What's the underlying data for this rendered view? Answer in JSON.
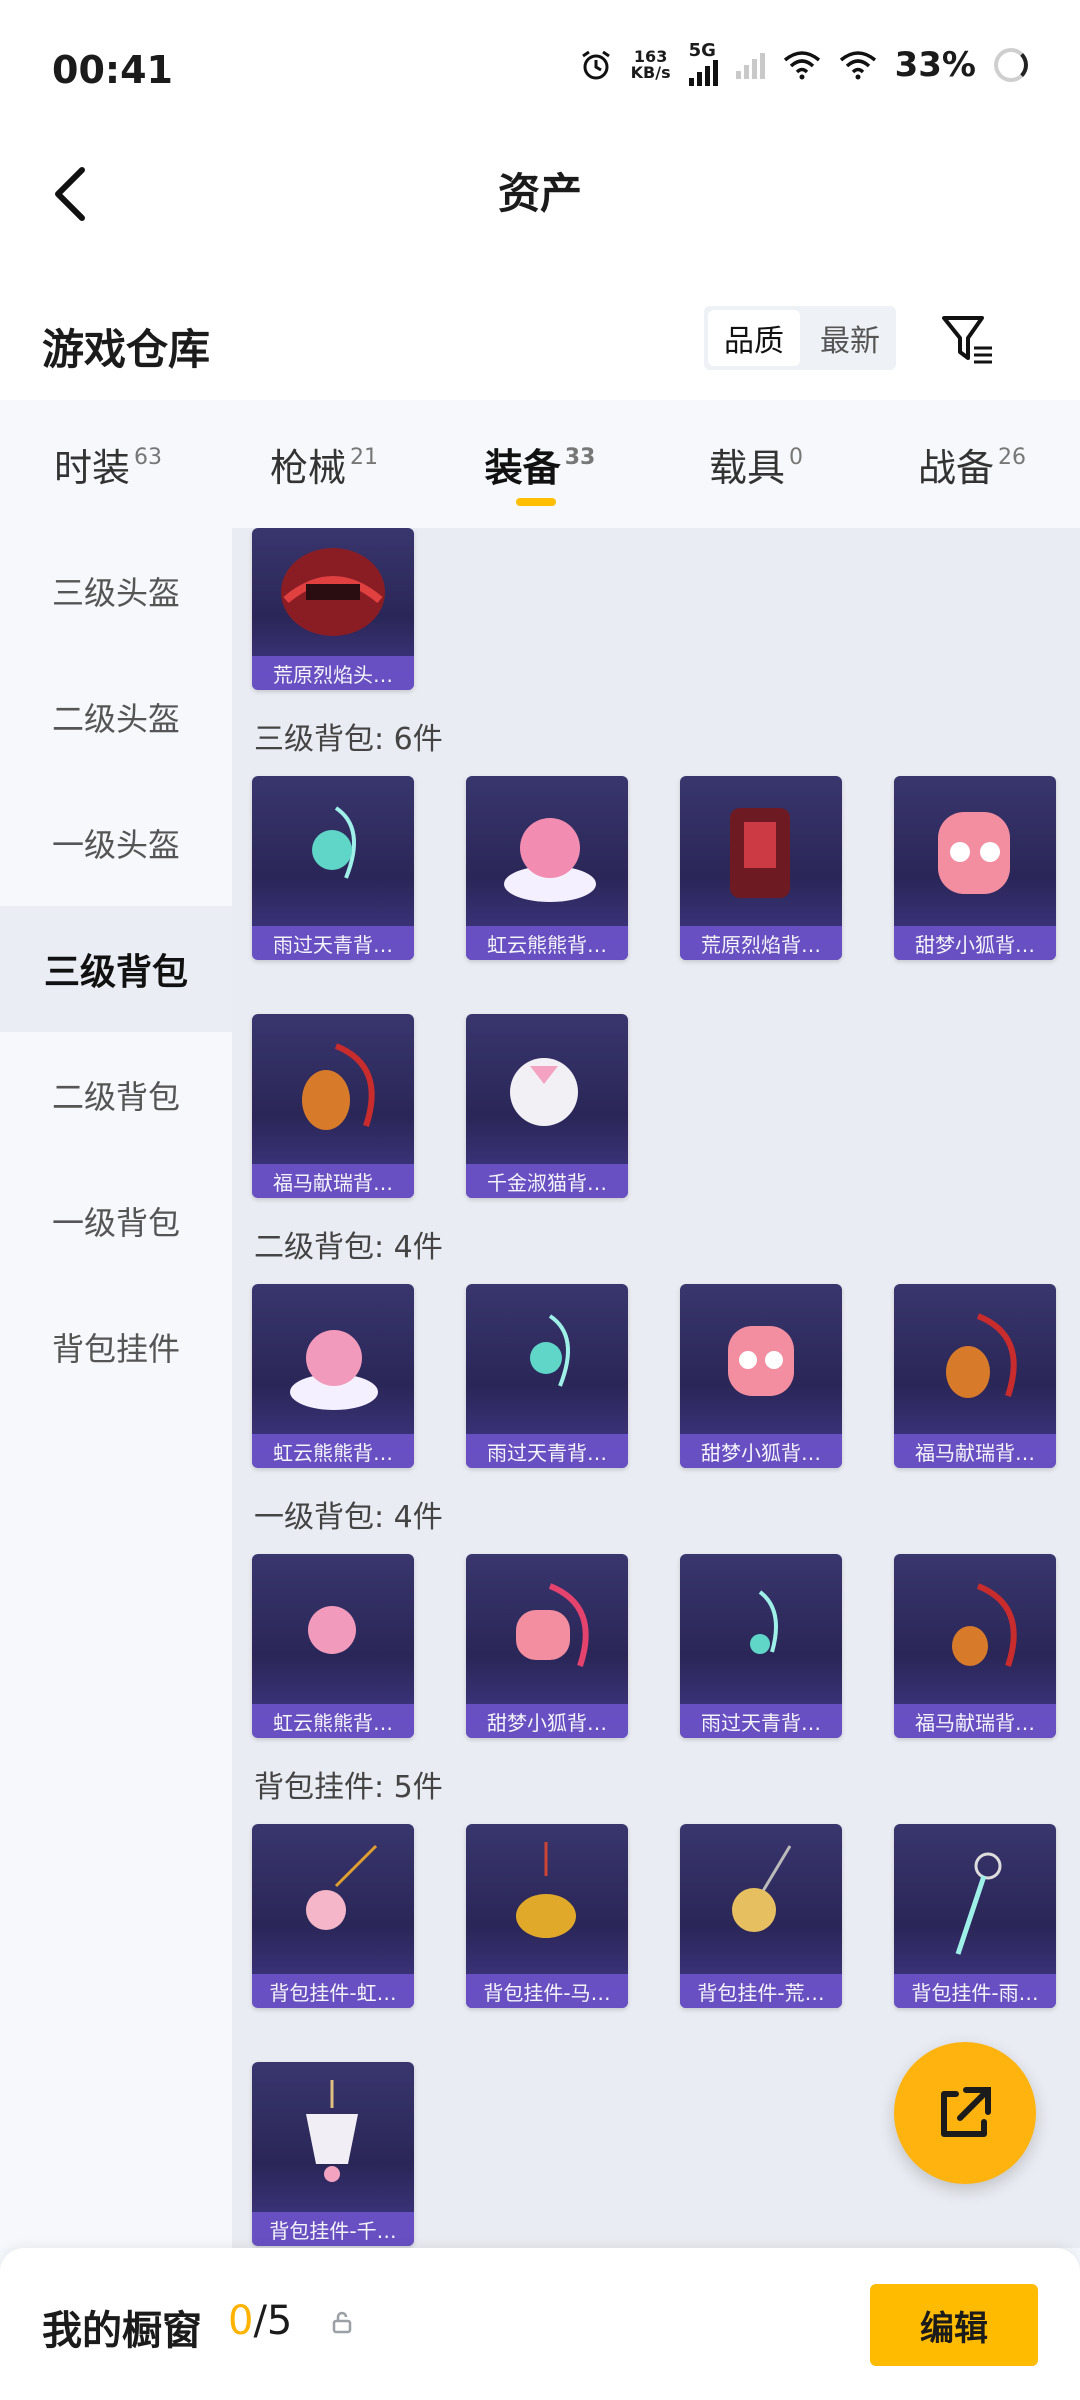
{
  "status": {
    "time": "00:41",
    "speed_top": "163",
    "speed_unit": "KB/s",
    "network": "5G",
    "battery": "33%"
  },
  "header": {
    "title": "资产"
  },
  "section": {
    "title": "游戏仓库",
    "sort": [
      "品质",
      "最新"
    ]
  },
  "tabs": [
    {
      "label": "时装",
      "count": "63"
    },
    {
      "label": "枪械",
      "count": "21"
    },
    {
      "label": "装备",
      "count": "33"
    },
    {
      "label": "载具",
      "count": "0"
    },
    {
      "label": "战备",
      "count": "26"
    }
  ],
  "sidebar": [
    "三级头盔",
    "二级头盔",
    "一级头盔",
    "三级背包",
    "二级背包",
    "一级背包",
    "背包挂件"
  ],
  "content": {
    "helmet": {
      "item": "荒原烈焰头…"
    },
    "lv3": {
      "label": "三级背包: 6件",
      "items": [
        "雨过天青背…",
        "虹云熊熊背…",
        "荒原烈焰背…",
        "甜梦小狐背…",
        "福马献瑞背…",
        "千金淑猫背…"
      ]
    },
    "lv2": {
      "label": "二级背包: 4件",
      "items": [
        "虹云熊熊背…",
        "雨过天青背…",
        "甜梦小狐背…",
        "福马献瑞背…"
      ]
    },
    "lv1": {
      "label": "一级背包: 4件",
      "items": [
        "虹云熊熊背…",
        "甜梦小狐背…",
        "雨过天青背…",
        "福马献瑞背…"
      ]
    },
    "charm": {
      "label": "背包挂件: 5件",
      "items": [
        "背包挂件-虹…",
        "背包挂件-马…",
        "背包挂件-荒…",
        "背包挂件-雨…",
        "背包挂件-千…"
      ]
    }
  },
  "bottom": {
    "title": "我的橱窗",
    "current": "0",
    "total": "/5",
    "edit": "编辑"
  },
  "colors": {
    "accent": "#ffbb00",
    "card_bg": "#2a2657",
    "card_label": "#6b52c7"
  }
}
